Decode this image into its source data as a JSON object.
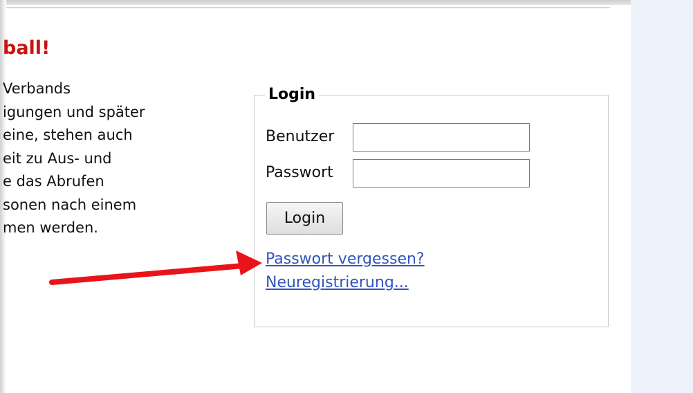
{
  "page": {
    "heading": "ball!",
    "intro_lines": [
      "Verbands",
      "igungen und später",
      "eine, stehen auch",
      "eit zu Aus- und",
      "e das Abrufen",
      "sonen nach einem",
      "men werden."
    ]
  },
  "login": {
    "legend": "Login",
    "username_label": "Benutzer",
    "username_value": "",
    "password_label": "Passwort",
    "password_value": "",
    "button_label": "Login",
    "forgot_password_link": "Passwort vergessen?",
    "register_link": "Neuregistrierung..."
  },
  "annotation": {
    "arrow_color": "#e8141a",
    "arrow_icon": "red-arrow-icon"
  },
  "colors": {
    "heading": "#cc1111",
    "link": "#3355bb",
    "right_panel": "#eef2fa"
  }
}
